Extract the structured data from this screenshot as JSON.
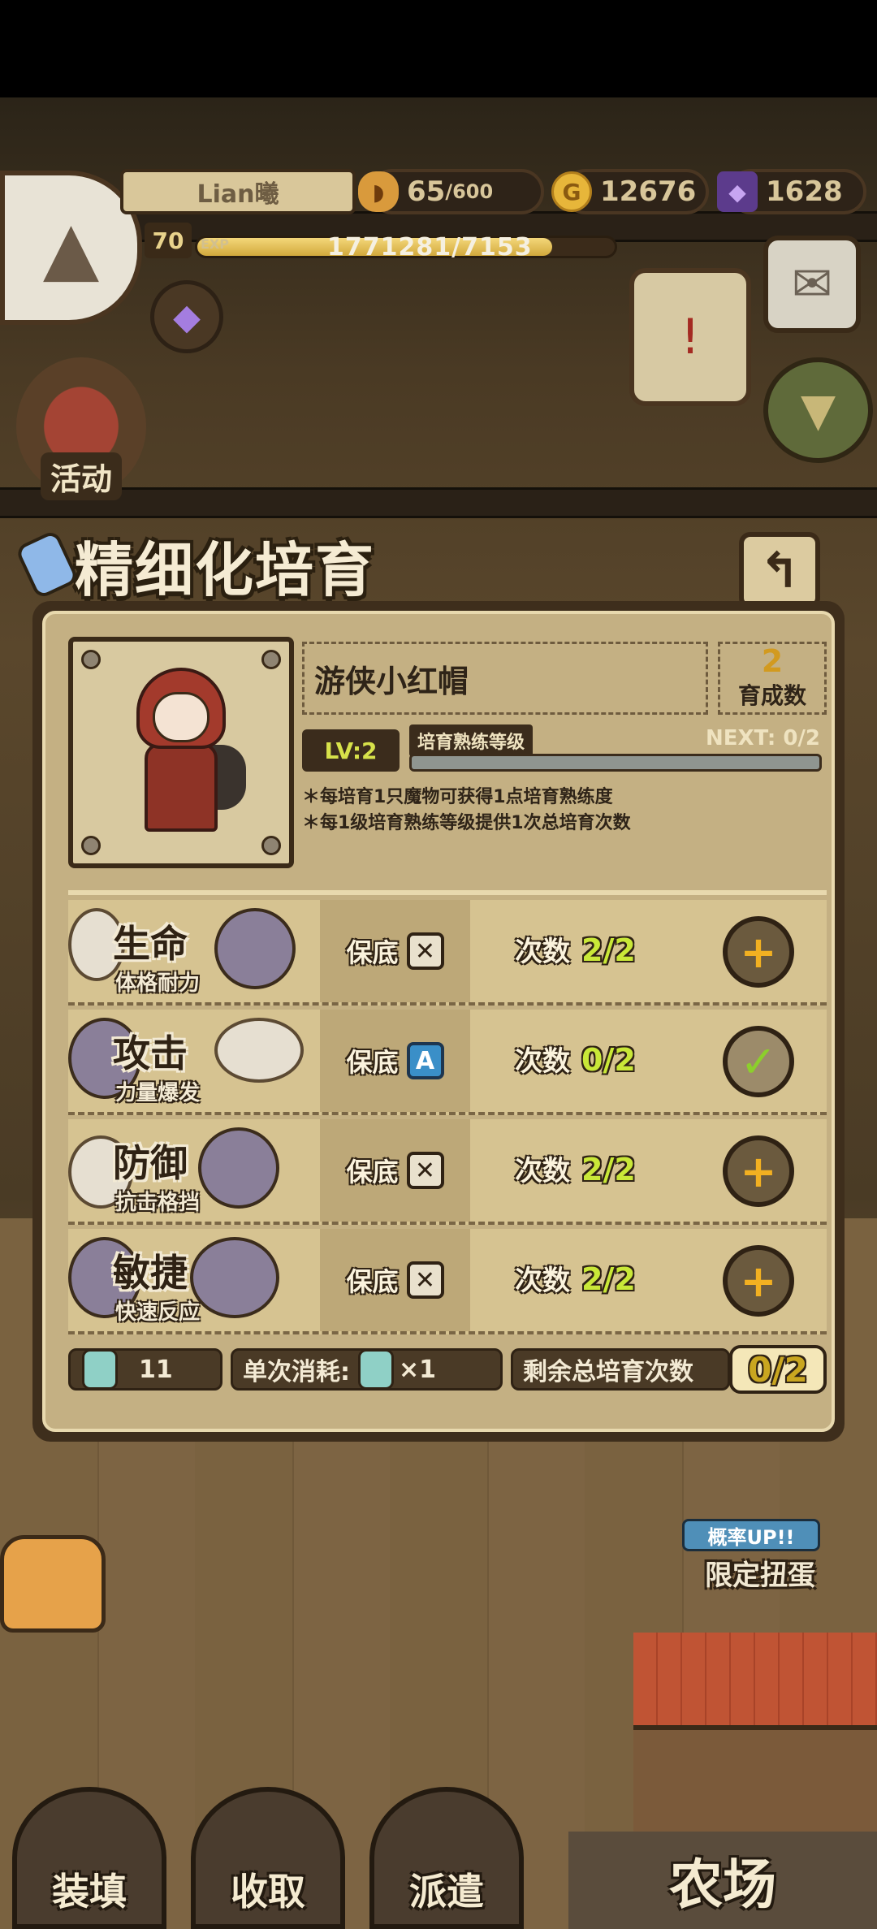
{
  "hud": {
    "player_name": "Lian曦",
    "level": "70",
    "exp_label": "EXP",
    "exp_text": "1771281/7153",
    "exp_progress": 0.85,
    "stamina_current": "65",
    "stamina_max": "/600",
    "gold": "12676",
    "gems": "1628",
    "activity_label": "活动"
  },
  "page": {
    "title": "精细化培育",
    "back_icon": "back-arrow-icon"
  },
  "character": {
    "name": "游侠小红帽",
    "raise_count": "2",
    "raise_count_label": "育成数",
    "lv": "LV:2",
    "proficiency_label": "培育熟练等级",
    "next": "NEXT: 0/2",
    "proficiency_progress": 0,
    "note1": "＊每培育1只魔物可获得1点培育熟练度",
    "note2": "＊每1级培育熟练等级提供1次总培育次数"
  },
  "stats": [
    {
      "name": "生命",
      "sub": "体格耐力",
      "guarantee_label": "保底",
      "guarantee_icon": "X",
      "guarantee_on": false,
      "times_label": "次数",
      "times_value": "2/2",
      "action": "plus"
    },
    {
      "name": "攻击",
      "sub": "力量爆发",
      "guarantee_label": "保底",
      "guarantee_icon": "A",
      "guarantee_on": true,
      "times_label": "次数",
      "times_value": "0/2",
      "action": "check"
    },
    {
      "name": "防御",
      "sub": "抗击格挡",
      "guarantee_label": "保底",
      "guarantee_icon": "X",
      "guarantee_on": false,
      "times_label": "次数",
      "times_value": "2/2",
      "action": "plus"
    },
    {
      "name": "敏捷",
      "sub": "快速反应",
      "guarantee_label": "保底",
      "guarantee_icon": "X",
      "guarantee_on": false,
      "times_label": "次数",
      "times_value": "2/2",
      "action": "plus"
    }
  ],
  "footer": {
    "potion_count": "11",
    "single_cost_label": "单次消耗:",
    "single_cost_value": "×1",
    "remaining_label": "剩余总培育次数",
    "remaining_value": "0/2"
  },
  "scene": {
    "gacha_tag": "概率UP!!",
    "gacha_name": "限定扭蛋",
    "nav": [
      "装填",
      "收取",
      "派遣"
    ],
    "farm": "农场"
  }
}
